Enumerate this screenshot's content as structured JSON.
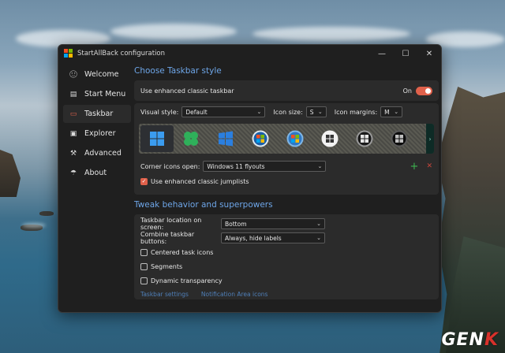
{
  "window": {
    "title": "StartAllBack configuration",
    "controls": [
      "—",
      "☐",
      "✕"
    ]
  },
  "sidebar": {
    "items": [
      {
        "label": "Welcome",
        "icon": "smiley-icon",
        "glyph": "ᵕ̈"
      },
      {
        "label": "Start Menu",
        "icon": "start-menu-icon",
        "glyph": "▤"
      },
      {
        "label": "Taskbar",
        "icon": "taskbar-icon",
        "glyph": "▭"
      },
      {
        "label": "Explorer",
        "icon": "explorer-icon",
        "glyph": "▣"
      },
      {
        "label": "Advanced",
        "icon": "wrench-icon",
        "glyph": "🔧"
      },
      {
        "label": "About",
        "icon": "info-icon",
        "glyph": "☂"
      }
    ],
    "active_index": 2
  },
  "taskbar_style": {
    "section_title": "Choose Taskbar style",
    "enhanced_label": "Use enhanced classic taskbar",
    "enhanced_state": "On",
    "visual_style_label": "Visual style:",
    "visual_style_value": "Default",
    "icon_size_label": "Icon size:",
    "icon_size_value": "S",
    "icon_margins_label": "Icon margins:",
    "icon_margins_value": "M",
    "preview_icons": [
      "windows11-logo-icon",
      "clover-icon",
      "windows10-logo-icon",
      "vista-orb-icon",
      "win7-orb-icon",
      "xp-logo-icon",
      "vista-dark-orb-icon",
      "win8-orb-icon"
    ],
    "corner_icons_label": "Corner icons open:",
    "corner_icons_value": "Windows 11 flyouts",
    "jumplists_label": "Use enhanced classic jumplists",
    "jumplists_checked": true,
    "add_glyph": "+",
    "remove_glyph": "✕"
  },
  "tweak": {
    "section_title": "Tweak behavior and superpowers",
    "location_label": "Taskbar location on screen:",
    "location_value": "Bottom",
    "combine_label": "Combine taskbar buttons:",
    "combine_value": "Always, hide labels",
    "checks": [
      {
        "label": "Centered task icons",
        "checked": false
      },
      {
        "label": "Segments",
        "checked": false
      },
      {
        "label": "Dynamic transparency",
        "checked": false
      }
    ],
    "links": [
      "Taskbar settings",
      "Notification Area icons"
    ]
  },
  "watermark": {
    "text_a": "GEN",
    "text_b": "K"
  },
  "colors": {
    "accent": "#e0614b",
    "link": "#4f7fb8",
    "heading": "#6ea6e8",
    "window_bg": "#1f1f1f"
  }
}
